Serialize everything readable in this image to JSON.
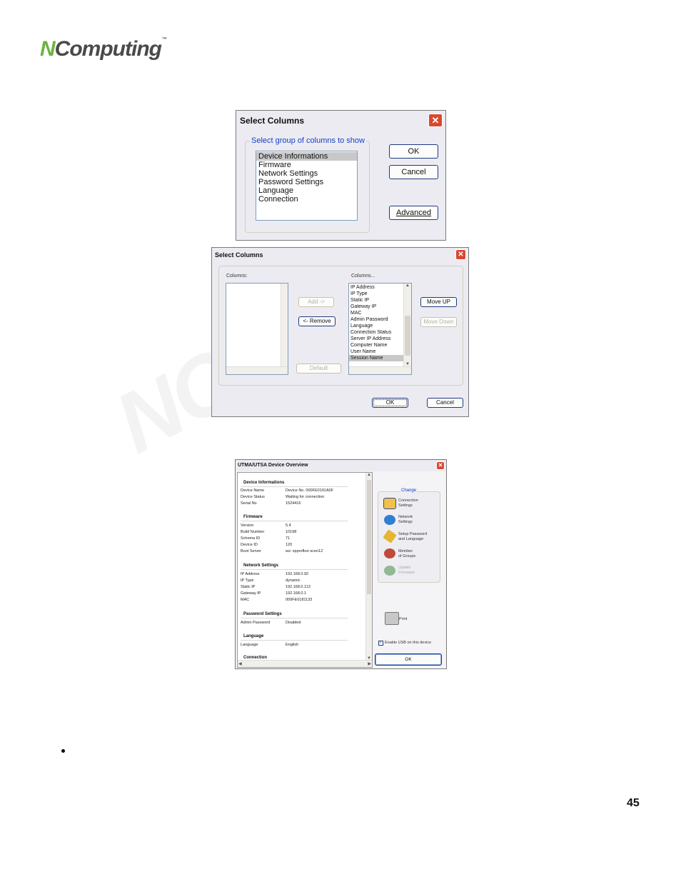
{
  "logo": {
    "n": "N",
    "rest": "Computing",
    "tm": "™"
  },
  "watermark": "NComp",
  "dialog1": {
    "title": "Select Columns",
    "close": "✕",
    "group_label": "Select group of columns to show",
    "items": [
      "Device Informations",
      "Firmware",
      "Network Settings",
      "Password Settings",
      "Language",
      "Connection"
    ],
    "buttons": {
      "ok": "OK",
      "cancel": "Cancel",
      "advanced": "Advanced"
    }
  },
  "dialog2": {
    "title": "Select Columns",
    "close": "✕",
    "left_label": "Columns:",
    "right_label": "Columns...",
    "right_items": [
      "IP Address",
      "IP Type",
      "Static IP",
      "Gateway IP",
      "MAC",
      "Admin Password",
      "Language",
      "Connection Status",
      "Server IP Address",
      "Computer Name",
      "User Name",
      "Session Name"
    ],
    "buttons": {
      "add": "Add ->",
      "remove": "<- Remove",
      "default": "Default",
      "move_up": "Move UP",
      "move_down": "Move Down",
      "ok": "OK",
      "cancel": "Cancel"
    }
  },
  "dialog3": {
    "title": "UTMA/UTSA Device Overview",
    "close": "✕",
    "sections": {
      "device_info": "Device Informations",
      "firmware": "Firmware",
      "network": "Network Settings",
      "password": "Password Settings",
      "language": "Language",
      "connection": "Connection"
    },
    "device_rows": [
      {
        "k": "Device Name",
        "v": "Device No. 000FE0191A0F"
      },
      {
        "k": "Device Status",
        "v": "Waiting for connection"
      },
      {
        "k": "Serial No",
        "v": "1524416"
      }
    ],
    "firmware_rows": [
      {
        "k": "Version",
        "v": "5.4"
      },
      {
        "k": "Build Number",
        "v": "10198"
      },
      {
        "k": "Schema ID",
        "v": "71"
      },
      {
        "k": "Device ID",
        "v": "120"
      },
      {
        "k": "Boot Server",
        "v": "ws: xpprofkor-scen12"
      }
    ],
    "network_rows": [
      {
        "k": "IP Address",
        "v": "192.168.0.92"
      },
      {
        "k": "IP Type",
        "v": "dynamic"
      },
      {
        "k": "Static IP",
        "v": "192.168.0.113"
      },
      {
        "k": "Gateway IP",
        "v": "192.168.0.1"
      },
      {
        "k": "MAC",
        "v": "000FE0181133"
      }
    ],
    "password_rows": [
      {
        "k": "Admin Password",
        "v": "Disabled"
      }
    ],
    "language_rows": [
      {
        "k": "Language",
        "v": "English"
      }
    ],
    "change_label": "Change",
    "side_items": {
      "connection": "Connection\nSettings",
      "network": "Network\nSettings",
      "password": "Setup Password\nand Language",
      "groups": "Member\nof Groups",
      "firmware": "Update\nFirmware"
    },
    "print": "Print",
    "usb": "Enable USB on this device",
    "ok": "OK"
  },
  "page_number": "45"
}
